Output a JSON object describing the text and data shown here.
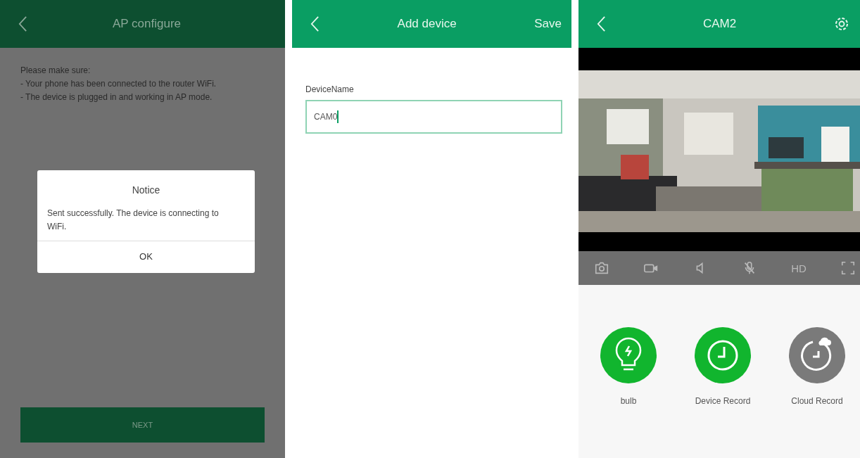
{
  "panels": [
    {
      "kind": "ap",
      "title": "AP configure",
      "dimmed": true,
      "intro": [
        "Please make sure:",
        "- Your phone has been connected to the router WiFi.",
        "- The device is plugged in and working in AP mode."
      ],
      "dialog": {
        "title": "Notice",
        "message": "Sent successfully. The device is connecting to WiFi.",
        "button": "OK"
      },
      "next_button": "NEXT"
    },
    {
      "kind": "add",
      "title": "Add device",
      "action": "Save",
      "field": {
        "label": "DeviceName",
        "value": "CAM0",
        "focused": true
      }
    },
    {
      "kind": "cam",
      "title": "CAM2",
      "toolbar": [
        {
          "kind": "camera"
        },
        {
          "kind": "video"
        },
        {
          "kind": "speaker"
        },
        {
          "kind": "mic"
        },
        {
          "kind": "text",
          "label": "HD"
        },
        {
          "kind": "fullscreen"
        }
      ],
      "features": [
        {
          "kind": "bulb",
          "label": "bulb",
          "on": true
        },
        {
          "kind": "record",
          "label": "Device Record",
          "on": true
        },
        {
          "kind": "cloud",
          "label": "Cloud Record",
          "on": false
        }
      ]
    }
  ]
}
